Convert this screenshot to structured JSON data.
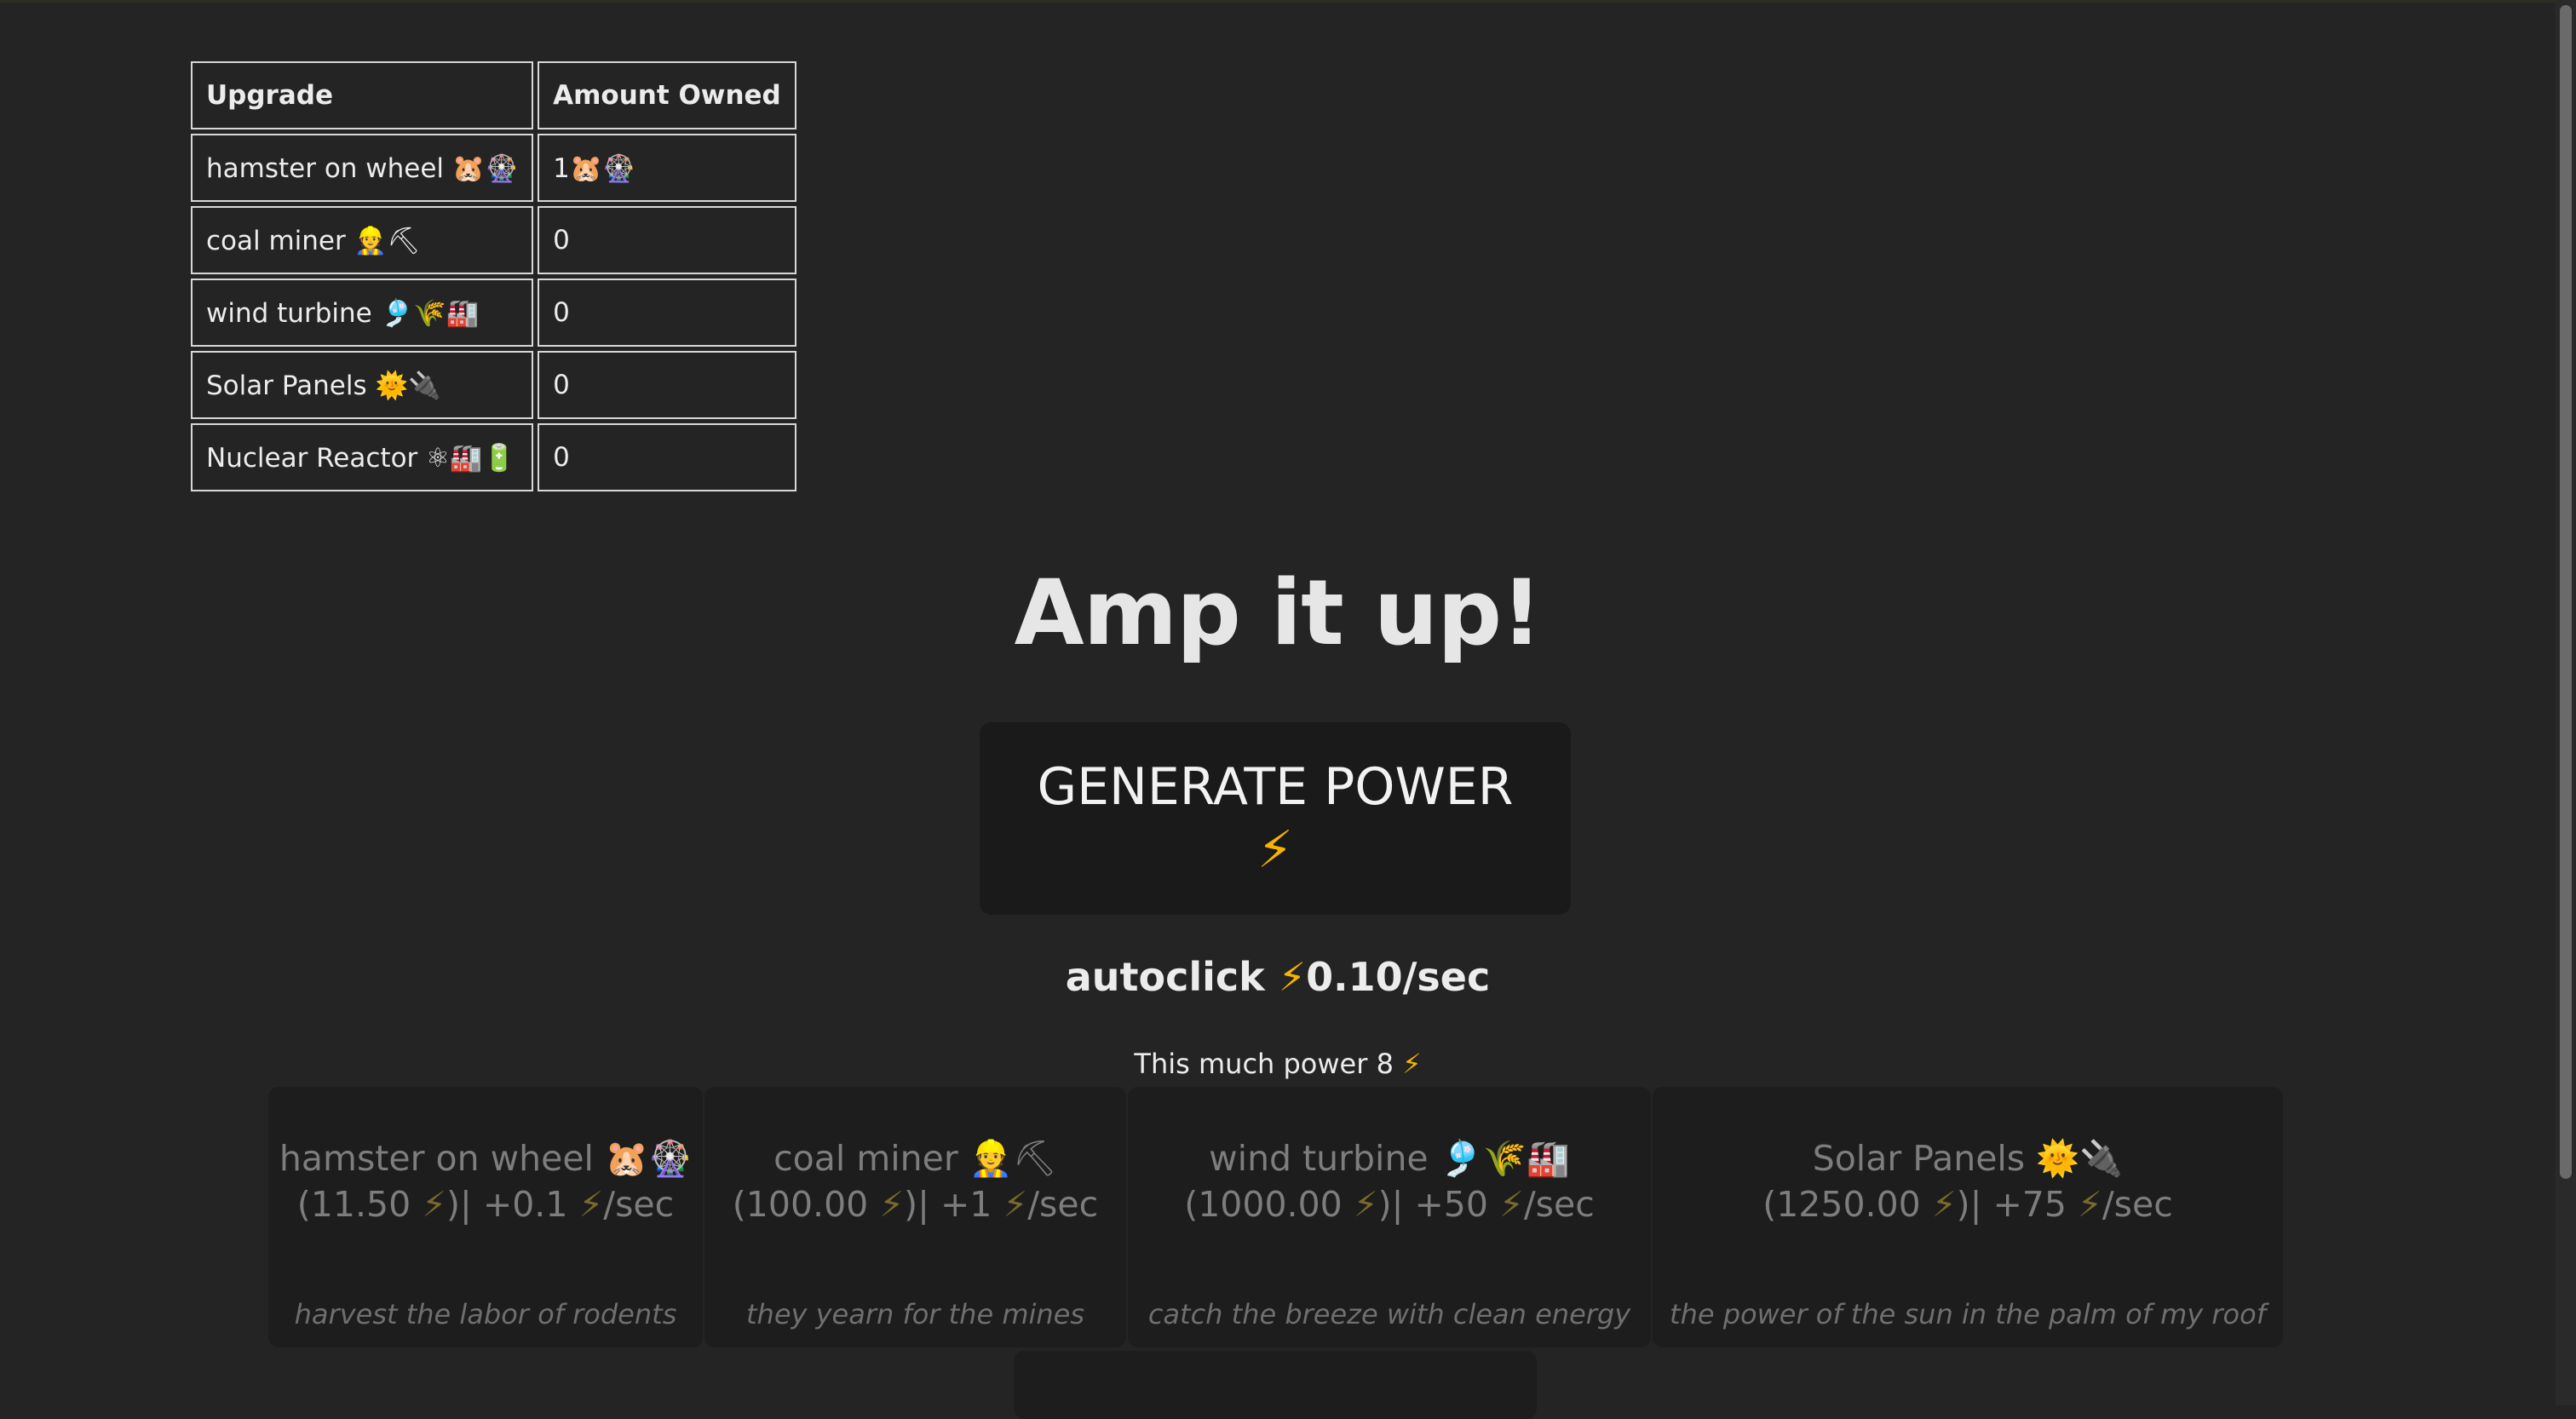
{
  "upgrades_table": {
    "headers": [
      "Upgrade",
      "Amount Owned"
    ],
    "rows": [
      {
        "name": "hamster on wheel 🐹🎡",
        "owned": "1🐹🎡"
      },
      {
        "name": "coal miner 👷⛏",
        "owned": "0"
      },
      {
        "name": "wind turbine 🎐🌾🏭",
        "owned": "0"
      },
      {
        "name": "Solar Panels 🌞🔌",
        "owned": "0"
      },
      {
        "name": "Nuclear Reactor ⚛🏭🔋",
        "owned": "0"
      }
    ]
  },
  "title": "Amp it up!",
  "generate_button": {
    "label": "GENERATE POWER",
    "icon": "⚡"
  },
  "autoclick": {
    "label": "autoclick",
    "icon": "⚡",
    "rate": "0.10/sec"
  },
  "power": {
    "label": "This much power",
    "value": "8",
    "icon": "⚡"
  },
  "shop": [
    {
      "name": "hamster on wheel 🐹🎡",
      "cost": "(11.50",
      "rate": ")| +0.1",
      "unit": "/sec",
      "desc": "harvest the labor of rodents"
    },
    {
      "name": "coal miner 👷⛏",
      "cost": "(100.00",
      "rate": ")| +1",
      "unit": "/sec",
      "desc": "they yearn for the mines"
    },
    {
      "name": "wind turbine 🎐🌾🏭",
      "cost": "(1000.00",
      "rate": ")| +50",
      "unit": "/sec",
      "desc": "catch the breeze with clean energy"
    },
    {
      "name": "Solar Panels 🌞🔌",
      "cost": "(1250.00",
      "rate": ")| +75",
      "unit": "/sec",
      "desc": "the power of the sun in the palm of my roof"
    }
  ],
  "colors": {
    "background": "#242424",
    "card": "#1d1d1d",
    "bolt": "#f5b400"
  }
}
